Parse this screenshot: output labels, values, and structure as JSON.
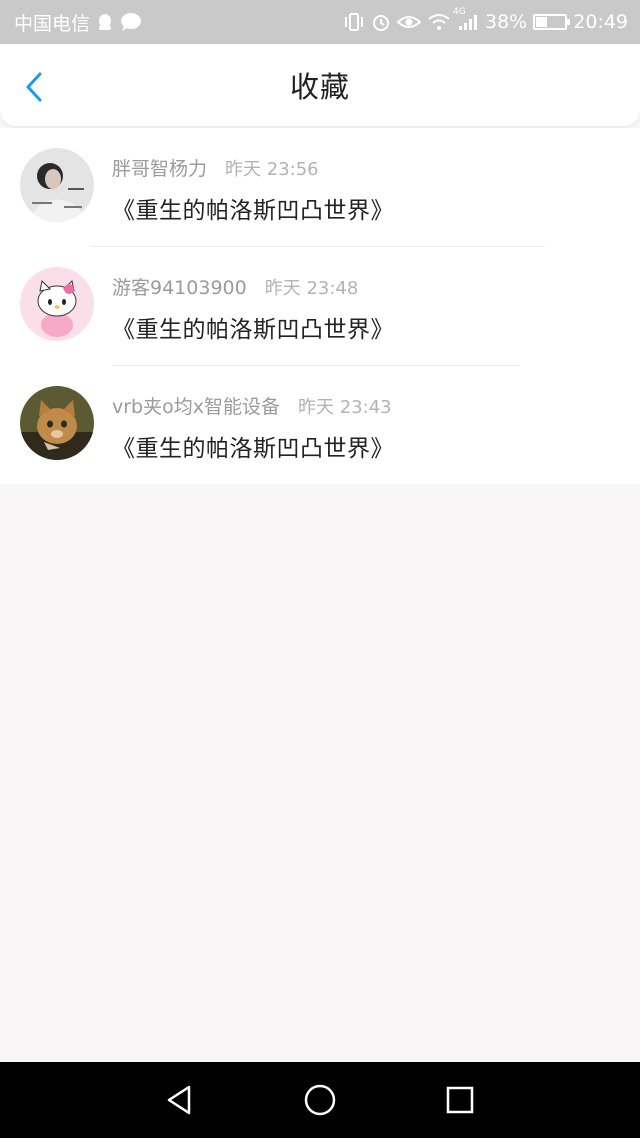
{
  "status_bar": {
    "carrier": "中国电信",
    "battery": "38%",
    "time": "20:49",
    "network": "4G",
    "battery_level": 0.38
  },
  "header": {
    "title": "收藏",
    "back_icon": "chevron-left-icon",
    "accent_color": "#1a9be8"
  },
  "favorites": [
    {
      "user": "胖哥智杨力",
      "time": "昨天 23:56",
      "book": "《重生的帕洛斯凹凸世界》",
      "avatar": "woman-portrait"
    },
    {
      "user": "游客94103900",
      "time": "昨天 23:48",
      "book": "《重生的帕洛斯凹凸世界》",
      "avatar": "hello-kitty"
    },
    {
      "user": "vrb夹o均x智能设备",
      "time": "昨天 23:43",
      "book": "《重生的帕洛斯凹凸世界》",
      "avatar": "cat"
    }
  ],
  "nav_bar": {
    "back": "triangle-back-icon",
    "home": "circle-home-icon",
    "recent": "square-recents-icon"
  }
}
